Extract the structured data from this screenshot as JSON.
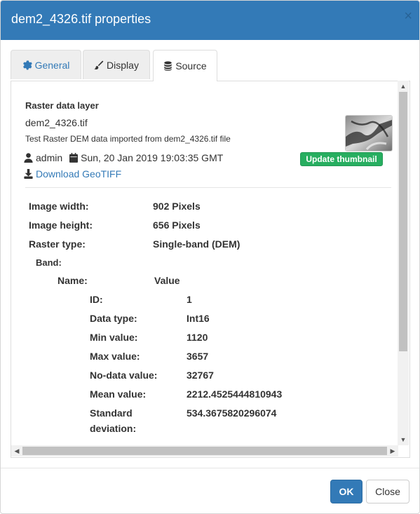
{
  "dialog": {
    "title": "dem2_4326.tif properties",
    "close_glyph": "×"
  },
  "tabs": [
    {
      "label": "General",
      "icon": "gear-icon",
      "active": false
    },
    {
      "label": "Display",
      "icon": "brush-icon",
      "active": false
    },
    {
      "label": "Source",
      "icon": "database-icon",
      "active": true
    }
  ],
  "source": {
    "section_title": "Raster data layer",
    "layer_name": "dem2_4326.tif",
    "description": "Test Raster DEM data imported from dem2_4326.tif file",
    "owner": "admin",
    "date": "Sun, 20 Jan 2019 19:03:35 GMT",
    "download_label": "Download GeoTIFF",
    "update_thumbnail_label": "Update thumbnail",
    "props": [
      {
        "label": "Image width:",
        "value": "902 Pixels"
      },
      {
        "label": "Image height:",
        "value": "656 Pixels"
      },
      {
        "label": "Raster type:",
        "value": "Single-band (DEM)"
      }
    ],
    "band": {
      "label": "Band:",
      "col_name": "Name:",
      "col_value": "Value",
      "rows": [
        {
          "label": "ID:",
          "value": "1"
        },
        {
          "label": "Data type:",
          "value": "Int16"
        },
        {
          "label": "Min value:",
          "value": "1120"
        },
        {
          "label": "Max value:",
          "value": "3657"
        },
        {
          "label": "No-data value:",
          "value": "32767"
        },
        {
          "label": "Mean value:",
          "value": "2212.4525444810943"
        },
        {
          "label": "Standard",
          "label2": "deviation:",
          "value": "534.3675820296074"
        }
      ]
    }
  },
  "footer": {
    "ok_label": "OK",
    "close_label": "Close"
  },
  "colors": {
    "header": "#337ab7",
    "update_button": "#27ae60",
    "link": "#337ab7"
  }
}
